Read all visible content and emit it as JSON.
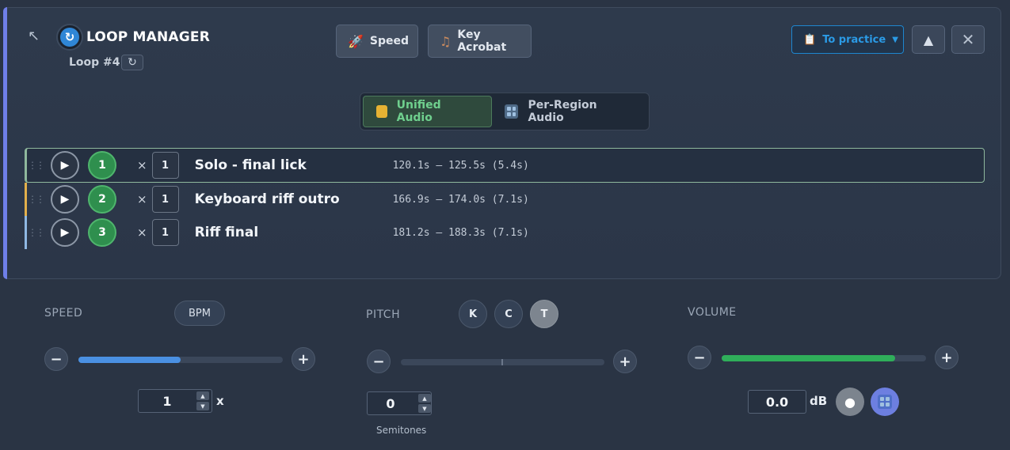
{
  "header": {
    "title": "LOOP MANAGER",
    "loop_label": "Loop #4",
    "reload_symbol": "↻",
    "collapse_symbol": "↖",
    "logo_symbol": "↻",
    "speed_button": "Speed",
    "key_button": "Key Acrobat",
    "practice_button": "To practice",
    "practice_caret": "▼",
    "up_symbol": "▲",
    "close_symbol": "✕"
  },
  "audio_mode": {
    "unified": "Unified Audio",
    "per_region": "Per-Region Audio",
    "selected": "unified"
  },
  "loops": [
    {
      "index": "1",
      "repeat": "1",
      "label": "Solo - final lick",
      "range": "120.1s – 125.5s (5.4s)",
      "accent": "#7fb38c",
      "selected": true
    },
    {
      "index": "2",
      "repeat": "1",
      "label": "Keyboard riff outro",
      "range": "166.9s – 174.0s (7.1s)",
      "accent": "#e3b04b",
      "selected": false
    },
    {
      "index": "3",
      "repeat": "1",
      "label": "Riff final",
      "range": "181.2s – 188.3s (7.1s)",
      "accent": "#8fb8e3",
      "selected": false
    }
  ],
  "speed": {
    "label": "SPEED",
    "mode_button": "BPM",
    "value": "1",
    "unit": "x",
    "fill_fraction": 0.5,
    "fill_color": "#4a90e2"
  },
  "pitch": {
    "label": "PITCH",
    "key_buttons": [
      "K",
      "C",
      "T"
    ],
    "active_key": "T",
    "value": "0",
    "unit_note": "Semitones"
  },
  "volume": {
    "label": "VOLUME",
    "value": "0.0",
    "unit": "dB",
    "fill_fraction": 0.85,
    "fill_color": "#2fae5a"
  }
}
